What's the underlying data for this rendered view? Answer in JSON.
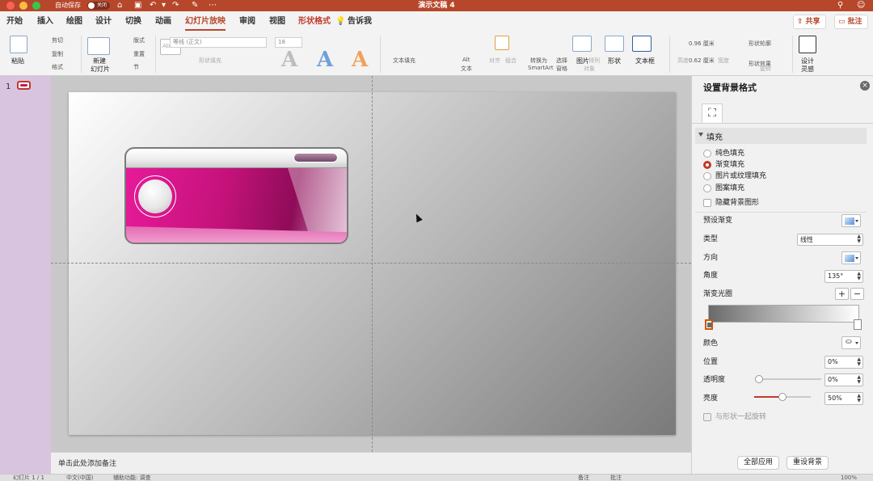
{
  "titlebar": {
    "autosave_label": "自动保存",
    "autosave_state": "关闭",
    "doc_title": "演示文稿 4",
    "colors": {
      "bar": "#b7472a"
    }
  },
  "tabs": [
    {
      "label": "开始"
    },
    {
      "label": "插入"
    },
    {
      "label": "绘图"
    },
    {
      "label": "设计"
    },
    {
      "label": "切换"
    },
    {
      "label": "动画"
    },
    {
      "label": "幻灯片放映",
      "active": true
    },
    {
      "label": "审阅"
    },
    {
      "label": "视图"
    },
    {
      "label": "形状格式",
      "contextual": true
    },
    {
      "label": "告诉我"
    }
  ],
  "top_buttons": {
    "share": "共享",
    "comments": "批注"
  },
  "ribbon": {
    "paste": "粘贴",
    "cut": "剪切",
    "copy": "复制",
    "format": "格式",
    "new_slide_1": "新建",
    "new_slide_2": "幻灯片",
    "layout": "版式",
    "reset": "重置",
    "section": "节",
    "font_name": "等线 (正文)",
    "font_size": "18",
    "shape_fill": "形状填充",
    "text_fill": "文本填充",
    "alt_text_1": "Alt",
    "alt_text_2": "文本",
    "align": "对齐",
    "group": "组合",
    "convert_1": "转换为",
    "convert_2": "SmartArt",
    "select_1": "选择",
    "select_2": "窗格",
    "picture": "图片",
    "arrange_1": "排列",
    "arrange_2": "对象",
    "shape": "形状",
    "textbox": "文本框",
    "height": "0.96 厘米",
    "width": "0.62 厘米",
    "height_lbl": "高度",
    "width_lbl": "宽度",
    "rotate": "旋转",
    "shape_outline": "形状轮廓",
    "shape_effect": "形状效果",
    "design_ideas_1": "设计",
    "design_ideas_2": "灵感",
    "styles_abc": "Abc"
  },
  "thumbnails": {
    "slide_number": "1"
  },
  "notes_placeholder": "单击此处添加备注",
  "format_pane": {
    "title": "设置背景格式",
    "fill_section": "填充",
    "fill_options": [
      {
        "label": "纯色填充",
        "selected": false
      },
      {
        "label": "渐变填充",
        "selected": true
      },
      {
        "label": "图片或纹理填充",
        "selected": false
      },
      {
        "label": "图案填充",
        "selected": false
      }
    ],
    "hide_bg": "隐藏背景图形",
    "preset_label": "预设渐变",
    "type_label": "类型",
    "type_value": "线性",
    "direction_label": "方向",
    "angle_label": "角度",
    "angle_value": "135°",
    "stops_label": "渐变光圈",
    "color_label": "颜色",
    "position_label": "位置",
    "position_value": "0%",
    "transparency_label": "透明度",
    "transparency_value": "0%",
    "brightness_label": "亮度",
    "brightness_value": "50%",
    "brightness_level": 0.5,
    "rotate_with_shape": "与形状一起旋转",
    "apply_all": "全部应用",
    "reset_bg": "重设背景",
    "accent_color": "#c0392b"
  },
  "statusbar": {
    "slide_info": "幻灯片 1 / 1",
    "language": "中文(中国)",
    "accessibility": "辅助功能: 调查",
    "notes": "备注",
    "comments": "批注",
    "zoom": "100%"
  }
}
